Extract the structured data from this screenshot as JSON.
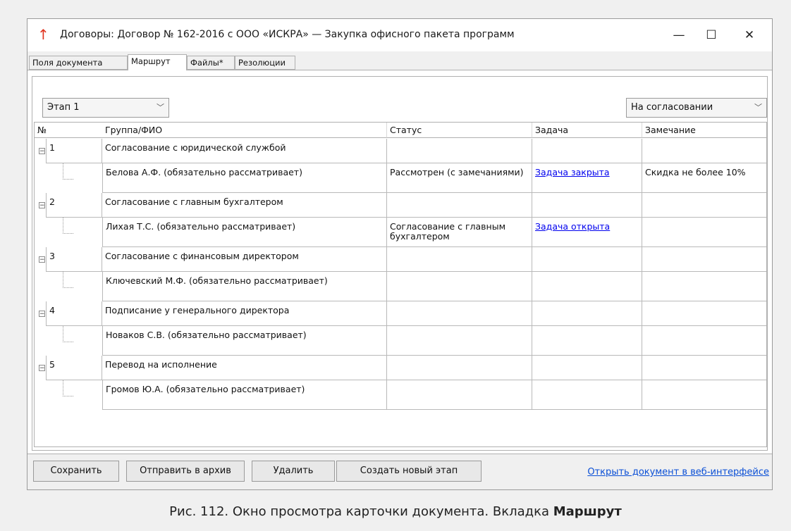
{
  "window": {
    "title": "Договоры: Договор № 162-2016 с ООО «ИСКРА» — Закупка офисного пакета программ",
    "controls": {
      "minimize": "—",
      "maximize": "☐",
      "close": "✕"
    },
    "accent_color": "#e0341f"
  },
  "tabs": [
    {
      "label": "Поля документа",
      "active": false
    },
    {
      "label": "Маршрут",
      "active": true
    },
    {
      "label": "Файлы*",
      "active": false
    },
    {
      "label": "Резолюции",
      "active": false
    }
  ],
  "filters": {
    "stage_select": "Этап 1",
    "status_select": "На согласовании"
  },
  "table": {
    "headers": [
      "№",
      "Группа/ФИО",
      "Статус",
      "Задача",
      "Замечание"
    ],
    "groups": [
      {
        "num": "1",
        "name": "Согласование с юридической службой",
        "member": "Белова А.Ф. (обязательно рассматривает)",
        "status": "Рассмотрен (с замечаниями)",
        "task": "Задача закрыта",
        "note": "Скидка не более 10%"
      },
      {
        "num": "2",
        "name": "Согласование с главным бухгалтером",
        "member": "Лихая Т.С. (обязательно рассматривает)",
        "status": "Согласование с главным бухгалтером",
        "task": "Задача открыта",
        "note": ""
      },
      {
        "num": "3",
        "name": "Согласование с финансовым директором",
        "member": "Ключевский М.Ф. (обязательно рассматривает)",
        "status": "",
        "task": "",
        "note": ""
      },
      {
        "num": "4",
        "name": "Подписание у генерального директора",
        "member": "Новаков С.В. (обязательно рассматривает)",
        "status": "",
        "task": "",
        "note": ""
      },
      {
        "num": "5",
        "name": "Перевод на исполнение",
        "member": "Громов Ю.А. (обязательно рассматривает)",
        "status": "",
        "task": "",
        "note": ""
      }
    ]
  },
  "buttons": {
    "save": "Сохранить",
    "archive": "Отправить в архив",
    "delete": "Удалить",
    "new_stage": "Создать новый этап",
    "open_web": "Открыть документ в веб-интерфейсе"
  },
  "caption": {
    "prefix": "Рис. 112. Окно просмотра карточки документа. Вкладка ",
    "bold": "Маршрут"
  }
}
